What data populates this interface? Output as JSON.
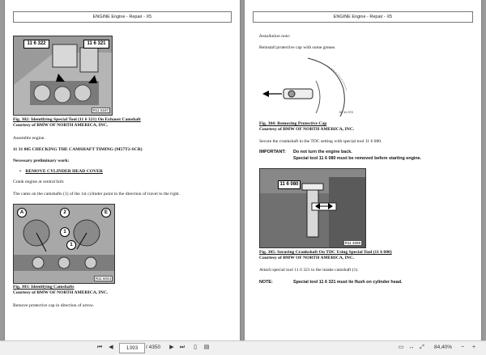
{
  "header_left": "ENGINE Engine - Repair - X5",
  "header_right": "ENGINE Engine - Repair - X5",
  "left": {
    "fig302": {
      "tool_a": "11 6 322",
      "tool_b": "11 6 321",
      "ref": "R11 6187"
    },
    "fig302_caption": "Fig. 302: Identifying Special Tool (11 6 321) On Exhaust Camshaft",
    "fig302_courtesy": "Courtesy of BMW OF NORTH AMERICA, INC.",
    "assemble": "Assemble engine.",
    "section_title": "11 31 005 CHECKING THE CAMSHAFT TIMING (M57T2-SCR)",
    "prelim": "Necessary preliminary work:",
    "prelim_item": "REMOVE CYLINDER HEAD COVER",
    "crank": "Crank engine at central bolt.",
    "cams": "The cams on the camshafts (1) of the 1st cylinder point in the direction of travel to the right.",
    "fig303": {
      "a": "A",
      "n2": "2",
      "e": "E",
      "n1a": "1",
      "n1b": "1",
      "ref": "R11 6044"
    },
    "fig303_caption": "Fig. 303: Identifying Camshafts",
    "fig303_courtesy": "Courtesy of BMW OF NORTH AMERICA, INC.",
    "remove_cap": "Remove protective cap in direction of arrow."
  },
  "right": {
    "install_note": "Installation note:",
    "reinstall": "Reinstall protective cap with some grease.",
    "fig304_ref": "34 11 072",
    "fig304_caption": "Fig. 304: Removing Protective Cap",
    "fig304_courtesy": "Courtesy of BMW OF NORTH AMERICA, INC.",
    "secure": "Secure the crankshaft in the TDC setting with special tool 11 6 080.",
    "important_label": "IMPORTANT:",
    "important_1": "Do not turn the engine back.",
    "important_2": "Special tool 11 6 080 must be removed before starting engine.",
    "fig305": {
      "tool": "11 6 080",
      "ref": "R11 4069"
    },
    "fig305_caption": "Fig. 305: Securing Crankshaft On TDC Using Special Tool (11 6 080)",
    "fig305_courtesy": "Courtesy of BMW OF NORTH AMERICA, INC.",
    "attach": "Attach special tool 11 6 321 to the intake camshaft (1).",
    "note_label": "NOTE:",
    "note_text": "Special tool 11 6 321 must lie flush on cylinder head."
  },
  "footer": {
    "current_page": "1393",
    "total": "/ 4350",
    "zoom": "84,40%"
  }
}
